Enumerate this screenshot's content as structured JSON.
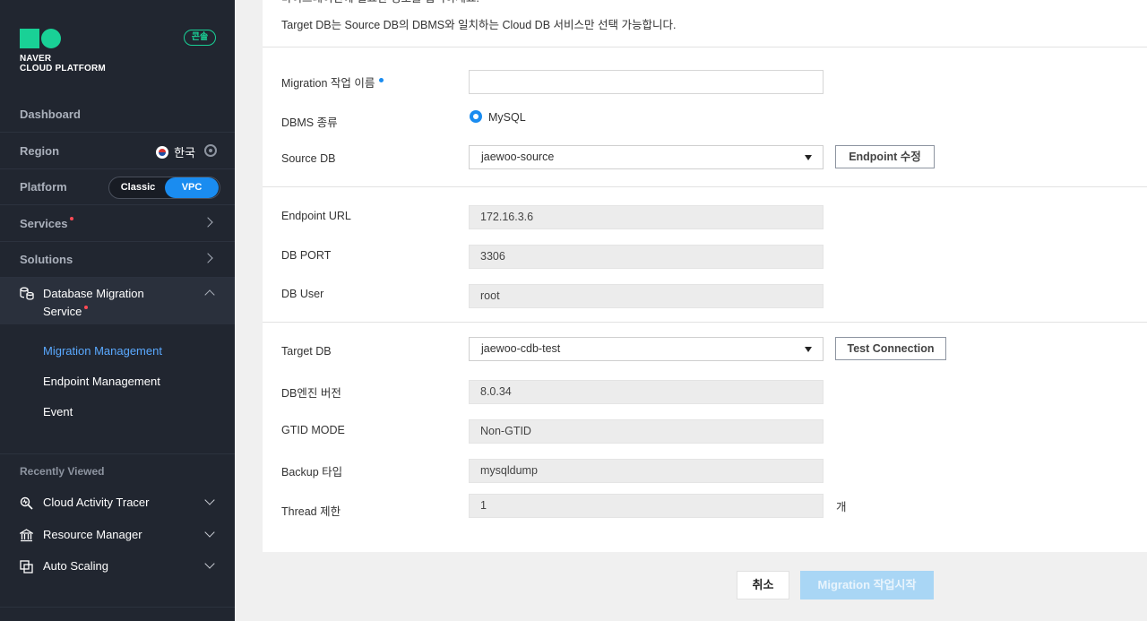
{
  "colors": {
    "brand_green": "#19d196",
    "accent_blue": "#1a8cf0",
    "sidebar_bg": "#212630",
    "new_dot": "#ff4a55"
  },
  "sidebar": {
    "logo_line1": "NAVER",
    "logo_line2": "CLOUD PLATFORM",
    "console_badge": "콘솔",
    "dashboard": "Dashboard",
    "region_label": "Region",
    "region_value": "한국",
    "platform_label": "Platform",
    "platform_classic": "Classic",
    "platform_vpc": "VPC",
    "services": "Services",
    "solutions": "Solutions",
    "dms_line1": "Database Migration",
    "dms_line2": "Service",
    "submenu": [
      "Migration Management",
      "Endpoint Management",
      "Event"
    ],
    "recently_viewed_title": "Recently Viewed",
    "recently_viewed": [
      "Cloud Activity Tracer",
      "Resource Manager",
      "Auto Scaling"
    ]
  },
  "intro": {
    "line1": "마이그레이션에 필요한 정보를 입력하세요.",
    "line2": "Target DB는 Source DB의 DBMS와 일치하는 Cloud DB 서비스만 선택 가능합니다."
  },
  "form": {
    "migration_name_label": "Migration 작업 이름",
    "migration_name_value": "",
    "dbms_label": "DBMS 종류",
    "dbms_value": "MySQL",
    "source_db_label": "Source DB",
    "source_db_value": "jaewoo-source",
    "endpoint_edit_button": "Endpoint 수정",
    "endpoint_url_label": "Endpoint URL",
    "endpoint_url_value": "172.16.3.6",
    "db_port_label": "DB PORT",
    "db_port_value": "3306",
    "db_user_label": "DB User",
    "db_user_value": "root",
    "target_db_label": "Target DB",
    "target_db_value": "jaewoo-cdb-test",
    "test_connection_button": "Test Connection",
    "engine_version_label": "DB엔진 버전",
    "engine_version_value": "8.0.34",
    "gtid_mode_label": "GTID MODE",
    "gtid_mode_value": "Non-GTID",
    "backup_type_label": "Backup 타입",
    "backup_type_value": "mysqldump",
    "thread_limit_label": "Thread 제한",
    "thread_limit_value": "1",
    "thread_unit": "개"
  },
  "footer": {
    "cancel_button": "취소",
    "start_button": "Migration 작업시작"
  }
}
